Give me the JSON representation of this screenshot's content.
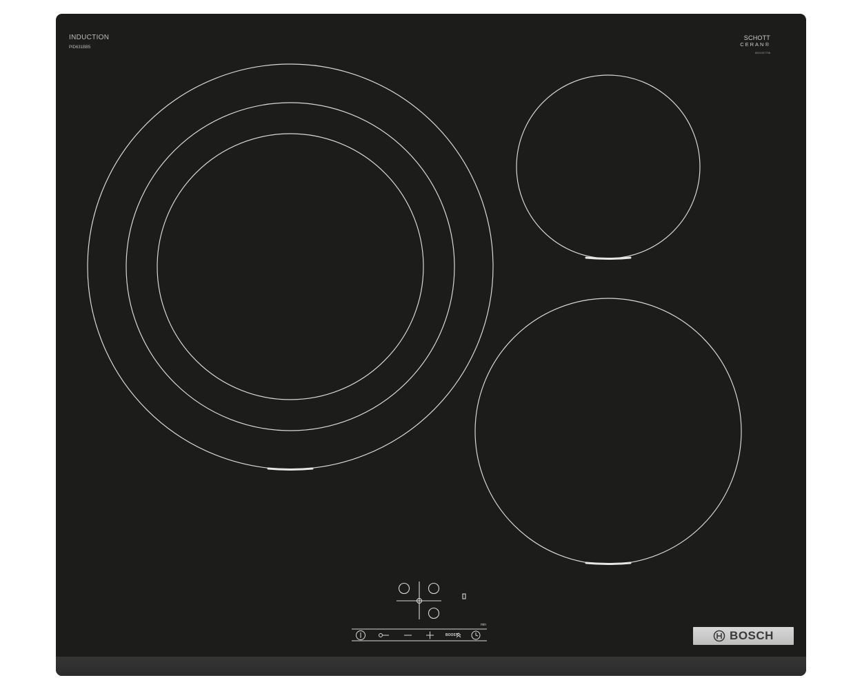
{
  "hob": {
    "type_label": "INDUCTION",
    "model": "PID631BB5",
    "glass_brand_line1": "SCHOTT",
    "glass_brand_line2": "CERAN®",
    "glass_code": "8001007758",
    "background_color": "#1c1c1b",
    "line_color": "#d9d9d9"
  },
  "zones": [
    {
      "name": "large-left-triple-zone",
      "rings": 3
    },
    {
      "name": "small-top-right-zone",
      "rings": 1
    },
    {
      "name": "medium-bottom-right-zone",
      "rings": 1
    }
  ],
  "controls": {
    "power_icon": "power-icon",
    "lock_icon": "key-lock-icon",
    "minus_symbol": "−",
    "plus_symbol": "+",
    "boost_label": "BOOST",
    "timer_icon": "clock-icon",
    "min_label": "min"
  },
  "brand": {
    "name": "BOSCH"
  }
}
